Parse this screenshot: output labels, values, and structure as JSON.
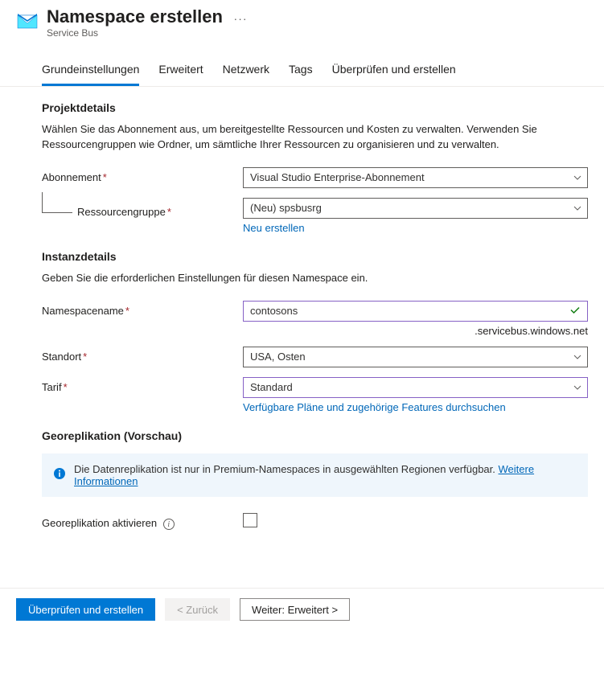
{
  "header": {
    "title": "Namespace erstellen",
    "subtitle": "Service Bus",
    "more": "···"
  },
  "tabs": {
    "basics": "Grundeinstellungen",
    "advanced": "Erweitert",
    "network": "Netzwerk",
    "tags": "Tags",
    "review": "Überprüfen und erstellen"
  },
  "project": {
    "section": "Projektdetails",
    "description": "Wählen Sie das Abonnement aus, um bereitgestellte Ressourcen und Kosten zu verwalten. Verwenden Sie Ressourcengruppen wie Ordner, um sämtliche Ihrer Ressourcen zu organisieren und zu verwalten.",
    "subscription_label": "Abonnement",
    "subscription_value": "Visual Studio Enterprise-Abonnement",
    "resourcegroup_label": "Ressourcengruppe",
    "resourcegroup_value": "(Neu) spsbusrg",
    "create_new": "Neu erstellen"
  },
  "instance": {
    "section": "Instanzdetails",
    "description": "Geben Sie die erforderlichen Einstellungen für diesen Namespace ein.",
    "name_label": "Namespacename",
    "name_value": "contosons",
    "name_suffix": ".servicebus.windows.net",
    "location_label": "Standort",
    "location_value": "USA, Osten",
    "tier_label": "Tarif",
    "tier_value": "Standard",
    "tier_link": "Verfügbare Pläne und zugehörige Features durchsuchen"
  },
  "georeplication": {
    "section": "Georeplikation (Vorschau)",
    "banner_text": "Die Datenreplikation ist nur in Premium-Namespaces in ausgewählten Regionen verfügbar. ",
    "banner_link": "Weitere Informationen",
    "enable_label": "Georeplikation aktivieren"
  },
  "footer": {
    "review": "Überprüfen und erstellen",
    "back": "<  Zurück",
    "next": "Weiter: Erweitert  >"
  }
}
